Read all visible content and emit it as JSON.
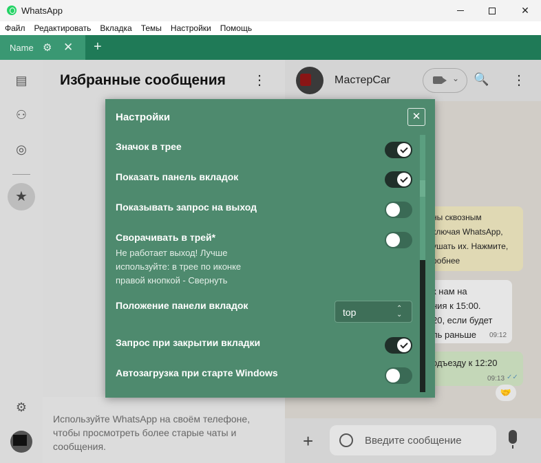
{
  "window": {
    "title": "WhatsApp"
  },
  "menu": [
    "Файл",
    "Редактировать",
    "Вкладка",
    "Темы",
    "Настройки",
    "Помощь"
  ],
  "tabs": [
    {
      "label": "Name"
    }
  ],
  "chat_list": {
    "title": "Избранные сообщения",
    "footer": "Используйте WhatsApp на своём телефоне, чтобы просмотреть более старые чаты и сообщения."
  },
  "chat": {
    "contact_name": "МастерCar",
    "messages": [
      {
        "text": "ны сквозным\nключая WhatsApp,\nушать их. Нажмите,\nробнее",
        "time": ""
      },
      {
        "text": "к нам на\nния к 15:00.\n20, если будет\nль раньше",
        "time": "09:12"
      },
      {
        "text": "одъезду к 12:20",
        "time": "09:13"
      }
    ],
    "reaction": "🤝",
    "composer_placeholder": "Введите сообщение"
  },
  "settings": {
    "title": "Настройки",
    "close_label": "✕",
    "rows": [
      {
        "label": "Значок в трее",
        "enabled": true
      },
      {
        "label": "Показать панель вкладок",
        "enabled": true
      },
      {
        "label": "Показывать запрос на выход",
        "enabled": false
      },
      {
        "label": "Сворачивать в трей*",
        "enabled": false,
        "note": "Не работает выход! Лучше используйте: в трее по иконке правой кнопкой - Свернуть"
      },
      {
        "label": "Положение панели вкладок",
        "select_value": "top"
      },
      {
        "label": "Запрос при закрытии вкладки",
        "enabled": true
      },
      {
        "label": "Автозагрузка при старте Windows",
        "enabled": false
      }
    ]
  },
  "colors": {
    "tab_bar": "#1f7a57",
    "dialog_bg": "#4e8a6e",
    "toggle_on": "#20302a",
    "toggle_off": "#3a6a55"
  }
}
